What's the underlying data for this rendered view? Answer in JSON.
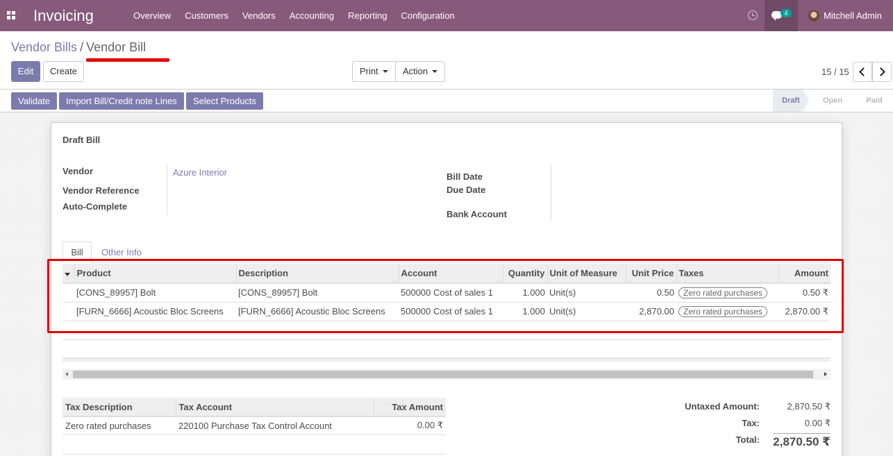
{
  "navbar": {
    "app_title": "Invoicing",
    "menu": [
      "Overview",
      "Customers",
      "Vendors",
      "Accounting",
      "Reporting",
      "Configuration"
    ],
    "chat_count": "4",
    "user_name": "Mitchell Admin",
    "color": "#875a7b"
  },
  "breadcrumb": {
    "parent": "Vendor Bills",
    "separator": "/",
    "current": "Vendor Bill"
  },
  "buttons": {
    "edit": "Edit",
    "create": "Create",
    "print": "Print",
    "action": "Action"
  },
  "pager": {
    "value": "15 / 15"
  },
  "statusbar": {
    "validate": "Validate",
    "import_lines": "Import Bill/Credit note Lines",
    "select_products": "Select Products",
    "stages": [
      "Draft",
      "Open",
      "Paid"
    ],
    "active_stage": "Draft"
  },
  "sheet": {
    "title": "Draft Bill",
    "vendor_label": "Vendor",
    "vendor_value": "Azure Interior",
    "vendor_ref_label": "Vendor Reference",
    "auto_complete_label": "Auto-Complete",
    "bill_date_label": "Bill Date",
    "due_date_label": "Due Date",
    "bank_account_label": "Bank Account",
    "tabs": [
      "Bill",
      "Other Info"
    ]
  },
  "lines": {
    "columns": [
      "Product",
      "Description",
      "Account",
      "Quantity",
      "Unit of Measure",
      "Unit Price",
      "Taxes",
      "Amount"
    ],
    "rows": [
      {
        "product": "[CONS_89957] Bolt",
        "description": "[CONS_89957] Bolt",
        "account": "500000 Cost of sales 1",
        "quantity": "1.000",
        "uom": "Unit(s)",
        "unit_price": "0.50",
        "taxes": "Zero rated purchases",
        "amount": "0.50 ₹"
      },
      {
        "product": "[FURN_6666] Acoustic Bloc Screens",
        "description": "[FURN_6666] Acoustic Bloc Screens",
        "account": "500000 Cost of sales 1",
        "quantity": "1.000",
        "uom": "Unit(s)",
        "unit_price": "2,870.00",
        "taxes": "Zero rated purchases",
        "amount": "2,870.00 ₹"
      }
    ]
  },
  "tax_table": {
    "columns": [
      "Tax Description",
      "Tax Account",
      "Tax Amount"
    ],
    "rows": [
      {
        "description": "Zero rated purchases",
        "account": "220100 Purchase Tax Control Account",
        "amount": "0.00 ₹"
      }
    ]
  },
  "totals": {
    "untaxed_label": "Untaxed Amount:",
    "untaxed_value": "2,870.50 ₹",
    "tax_label": "Tax:",
    "tax_value": "0.00 ₹",
    "total_label": "Total:",
    "total_value": "2,870.50 ₹"
  },
  "annotation_color": "#e40000"
}
